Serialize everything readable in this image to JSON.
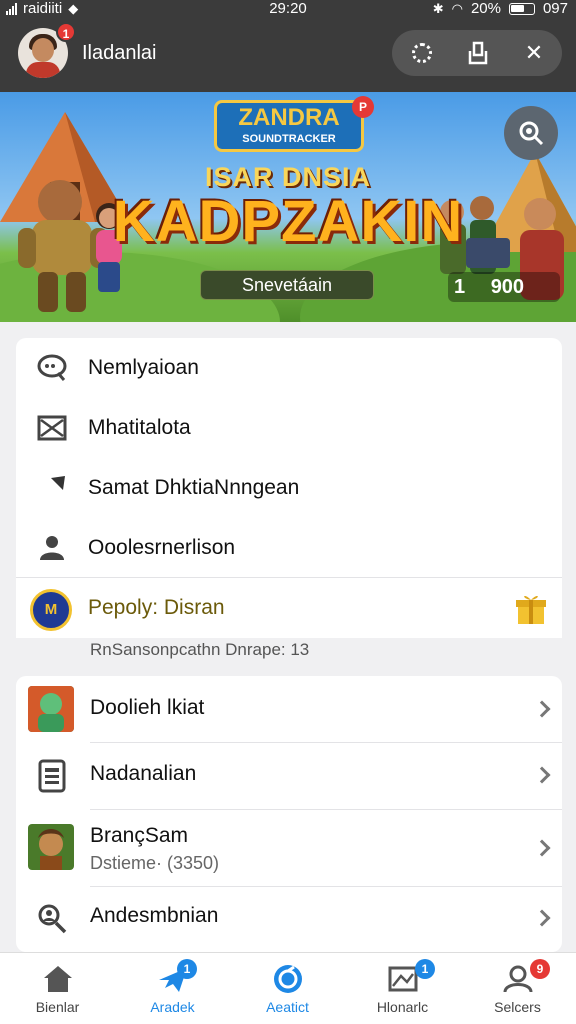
{
  "status_bar": {
    "carrier": "raidiiti",
    "time": "29:20",
    "battery": "20%",
    "extra": "097"
  },
  "header": {
    "username": "Iladanlai",
    "avatar_badge": "1",
    "actions": [
      "refresh-icon",
      "share-icon",
      "close-icon"
    ],
    "close_label": "✕"
  },
  "banner": {
    "logo_text": "ZANDRA",
    "logo_badge": "P",
    "logo_sub": "SOUNDTRACKER",
    "title_sub": "ISAR DNSIA",
    "title_main": "KADPZAKIN",
    "button_label": "Snevetáain",
    "counter_icon": "1",
    "counter_value": "900"
  },
  "menu1": {
    "items": [
      {
        "label": "Nemlyaioan",
        "icon": "chat-icon"
      },
      {
        "label": "Mhatitalota",
        "icon": "mail-icon"
      },
      {
        "label": "Samat DhktiaNnngean",
        "icon": "arrow-icon"
      },
      {
        "label": "Ooolesrnerlison",
        "icon": "people-icon"
      }
    ],
    "promo": {
      "logo": "M",
      "label": "Pepoly: Disran",
      "icon": "gift-icon"
    }
  },
  "caption": "RnSansonpcathn Dnrape: 13",
  "menu2": {
    "items": [
      {
        "label": "Doolieh lkiat",
        "icon": "game-thumb-1"
      },
      {
        "label": "Nadanalian",
        "icon": "document-icon"
      },
      {
        "label": "BrançSam",
        "sub": "Dstieme· (3350)",
        "icon": "game-thumb-2"
      },
      {
        "label": "Andesmbnian",
        "icon": "user-search-icon"
      }
    ]
  },
  "bottom_nav": {
    "tabs": [
      {
        "label": "Bienlar",
        "icon": "home-icon",
        "badge": ""
      },
      {
        "label": "Aradek",
        "icon": "plane-icon",
        "badge": "1"
      },
      {
        "label": "Aeatict",
        "icon": "compass-icon",
        "badge": ""
      },
      {
        "label": "Hlonarlc",
        "icon": "image-icon",
        "badge": "1"
      },
      {
        "label": "Selcers",
        "icon": "profile-icon",
        "badge": "9"
      }
    ],
    "active_index": 2
  },
  "colors": {
    "header_bg": "#3b3b3b",
    "accent": "#1e88e5",
    "badge": "#e53935",
    "title": "#ffb21e"
  }
}
